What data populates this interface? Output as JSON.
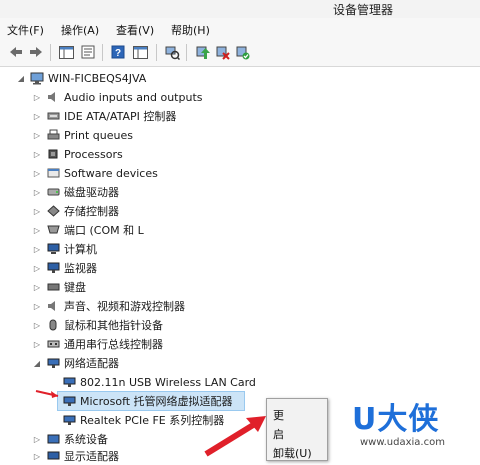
{
  "window": {
    "title": "设备管理器"
  },
  "menu": [
    "文件(F)",
    "操作(A)",
    "查看(V)",
    "帮助(H)"
  ],
  "tree": {
    "root": "WIN-FICBEQS4JVA",
    "categories": [
      {
        "label": "Audio inputs and outputs",
        "icon": "speaker-icon"
      },
      {
        "label": "IDE ATA/ATAPI 控制器",
        "icon": "ide-controller-icon"
      },
      {
        "label": "Print queues",
        "icon": "printer-icon"
      },
      {
        "label": "Processors",
        "icon": "processor-icon"
      },
      {
        "label": "Software devices",
        "icon": "software-device-icon"
      },
      {
        "label": "磁盘驱动器",
        "icon": "disk-drive-icon"
      },
      {
        "label": "存储控制器",
        "icon": "storage-controller-icon"
      },
      {
        "label": "端口 (COM 和 L",
        "icon": "port-icon"
      },
      {
        "label": "计算机",
        "icon": "computer-icon"
      },
      {
        "label": "监视器",
        "icon": "monitor-icon"
      },
      {
        "label": "键盘",
        "icon": "keyboard-icon"
      },
      {
        "label": "声音、视频和游戏控制器",
        "icon": "sound-icon"
      },
      {
        "label": "鼠标和其他指针设备",
        "icon": "mouse-icon"
      },
      {
        "label": "通用串行总线控制器",
        "icon": "usb-icon"
      }
    ],
    "network": {
      "label": "网络适配器",
      "children": [
        {
          "label": "802.11n USB Wireless LAN Card",
          "selected": false
        },
        {
          "label": "Microsoft 托管网络虚拟适配器",
          "selected": true
        },
        {
          "label": "Realtek PCIe FE 系列控制器",
          "selected": false
        }
      ]
    },
    "after": [
      {
        "label": "系统设备",
        "icon": "system-device-icon"
      },
      {
        "label": "显示适配器",
        "icon": "display-adapter-icon"
      }
    ]
  },
  "context_menu": [
    "更",
    "启",
    "卸载(U)"
  ],
  "watermark": {
    "logo": "U大侠",
    "url": "www.udaxia.com"
  },
  "colors": {
    "selection": "#cce4f7",
    "accent_arrow": "#e0202a",
    "watermark": "#1e6fd9"
  }
}
